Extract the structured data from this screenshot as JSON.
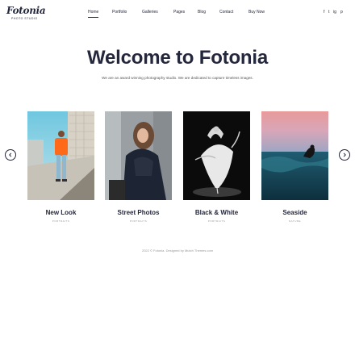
{
  "brand": {
    "logo_text": "Fotonia",
    "logo_tagline": "PHOTO STUDIO"
  },
  "nav": {
    "items": [
      {
        "label": "Home",
        "active": true
      },
      {
        "label": "Portfolio",
        "active": false
      },
      {
        "label": "Galleries",
        "active": false
      },
      {
        "label": "Pages",
        "active": false
      },
      {
        "label": "Blog",
        "active": false
      },
      {
        "label": "Contact",
        "active": false
      },
      {
        "label": "Buy Now",
        "active": false
      }
    ]
  },
  "social": [
    "f",
    "t",
    "ig",
    "p"
  ],
  "hero": {
    "title": "Welcome to Fotonia",
    "subtitle": "We are an award winning photography studio. We are dedicated to capture timeless images."
  },
  "gallery": {
    "cards": [
      {
        "title": "New Look",
        "category": "PORTRAITS"
      },
      {
        "title": "Street Photos",
        "category": "PORTRAITS"
      },
      {
        "title": "Black & White",
        "category": "PORTRAITS"
      },
      {
        "title": "Seaside",
        "category": "NATURE"
      }
    ]
  },
  "footer": {
    "text": "2022 © Fotonia. Designed by Mutch Themes.com"
  },
  "colors": {
    "accent": "#25283d",
    "background": "#ffffff"
  }
}
